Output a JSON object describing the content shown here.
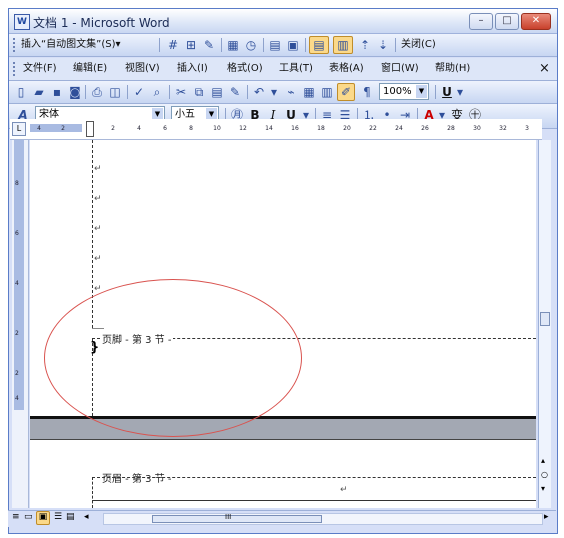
{
  "window": {
    "title": "文档 1 - Microsoft Word",
    "app_icon": "W",
    "buttons": {
      "minimize": "–",
      "maximize": "□",
      "close": "✕"
    }
  },
  "autotext_toolbar": {
    "insert_autotext": "插入“自动图文集”(S)▾",
    "close_label": "关闭(C)"
  },
  "menu": {
    "items": [
      "文件(F)",
      "编辑(E)",
      "视图(V)",
      "插入(I)",
      "格式(O)",
      "工具(T)",
      "表格(A)",
      "窗口(W)",
      "帮助(H)"
    ],
    "close_x": "×"
  },
  "standard_toolbar": {
    "zoom": "100%",
    "underline": "U"
  },
  "format_toolbar": {
    "style_icon": "A",
    "font_name": "宋体",
    "font_size": "小五",
    "bold": "B",
    "italic": "I",
    "underline": "U",
    "font_color": "A",
    "char_scale": "变",
    "enclose": "㊉"
  },
  "ruler": {
    "numbers": [
      "4",
      "2",
      "2",
      "4",
      "6",
      "8",
      "10",
      "12",
      "14",
      "16",
      "18",
      "20",
      "22",
      "24",
      "26",
      "28",
      "30",
      "32",
      "3"
    ],
    "corner": "L"
  },
  "vertical_ruler": {
    "numbers": [
      "8",
      "6",
      "4",
      "2",
      "2",
      "4"
    ]
  },
  "document": {
    "para_mark": "↵",
    "footer_label": "页脚 - 第 3 节 -",
    "header_label": "页眉 - 第 3 节 -",
    "cursor": "}"
  },
  "status": {
    "scroll_center": "III"
  },
  "colors": {
    "accent": "#d6dff7",
    "highlight_circle": "#d9534f"
  }
}
